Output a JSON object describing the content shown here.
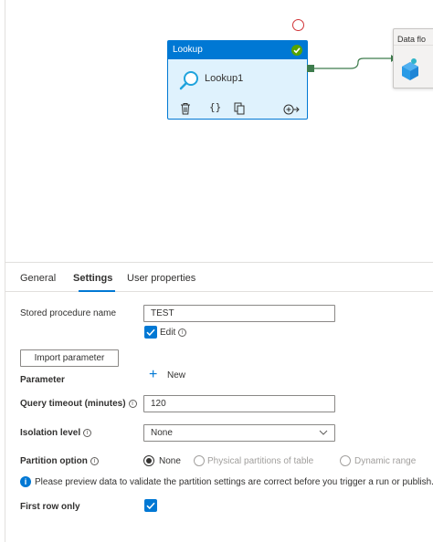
{
  "canvas": {
    "lookup_activity": {
      "type_label": "Lookup",
      "name": "Lookup1",
      "status": "success",
      "icons": [
        "lookup-magnifier-icon",
        "delete-icon",
        "code-braces-icon",
        "copy-icon",
        "add-output-icon"
      ]
    },
    "dataflow_activity": {
      "title": "Data flo",
      "icon": "dataflow-cube-icon"
    }
  },
  "tabs": [
    {
      "label": "General",
      "active": false
    },
    {
      "label": "Settings",
      "active": true
    },
    {
      "label": "User properties",
      "active": false
    }
  ],
  "settings": {
    "stored_procedure_name": {
      "label": "Stored procedure name",
      "value": "TEST"
    },
    "edit": {
      "label": "Edit",
      "checked": true
    },
    "import_parameter_label": "Import parameter",
    "parameter_label": "Parameter",
    "new_label": "New",
    "query_timeout": {
      "label": "Query timeout (minutes)",
      "value": "120"
    },
    "isolation_level": {
      "label": "Isolation level",
      "value": "None"
    },
    "partition_option": {
      "label": "Partition option",
      "options": [
        {
          "label": "None",
          "selected": true,
          "disabled": false
        },
        {
          "label": "Physical partitions of table",
          "selected": false,
          "disabled": true
        },
        {
          "label": "Dynamic range",
          "selected": false,
          "disabled": true
        }
      ]
    },
    "preview_info": "Please preview data to validate the partition settings are correct before you trigger a run or publish.",
    "first_row_only": {
      "label": "First row only",
      "checked": true
    }
  },
  "colors": {
    "accent": "#0078d4",
    "success": "#57a300",
    "error": "#d13438",
    "connector": "#3e7c4d"
  }
}
